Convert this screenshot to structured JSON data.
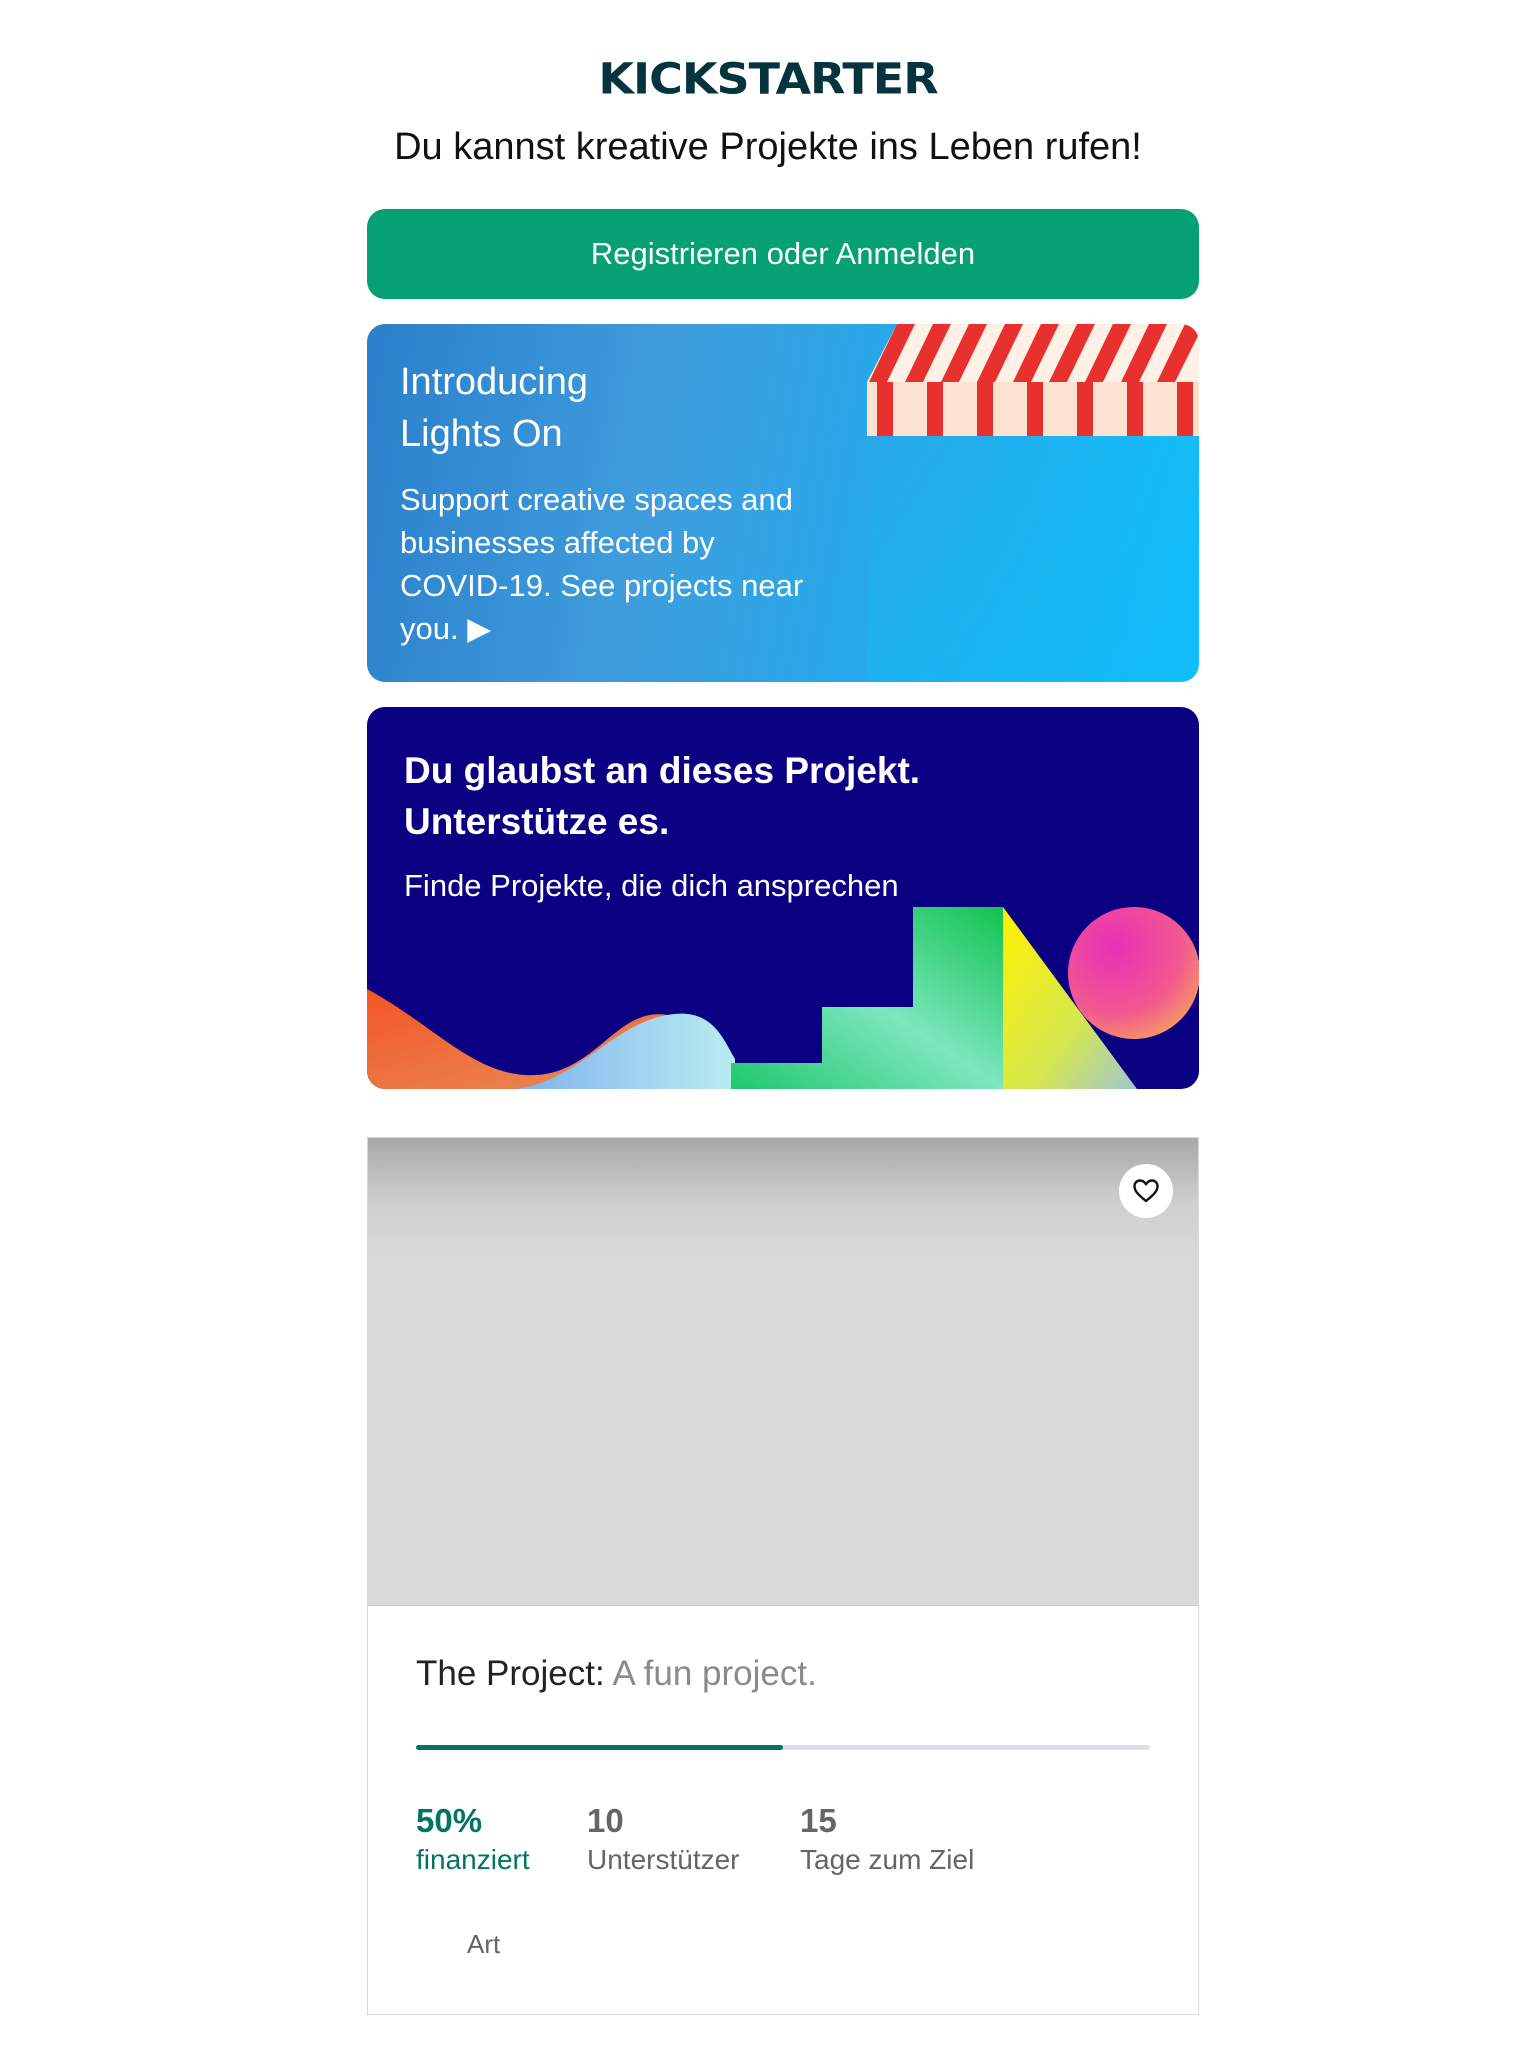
{
  "header": {
    "logo_text": "KICKSTARTER",
    "tagline": "Du kannst kreative Projekte ins Leben rufen!"
  },
  "signup_button": {
    "label": "Registrieren oder Anmelden"
  },
  "lights_on_card": {
    "title_line1": "Introducing",
    "title_line2": "Lights On",
    "body": "Support creative spaces and businesses affected by COVID-19. See projects near you. ▶"
  },
  "back_project_card": {
    "title_line1": "Du glaubst an dieses Projekt.",
    "title_line2": "Unterstütze es.",
    "subtitle": "Finde Projekte, die dich ansprechen"
  },
  "project": {
    "name": "The Project:",
    "blurb": "A fun project.",
    "progress_fraction": 0.5,
    "funded_value": "50%",
    "funded_label": "finanziert",
    "backers_value": "10",
    "backers_label": "Unterstützer",
    "days_value": "15",
    "days_label": "Tage zum Ziel",
    "category": "Art",
    "save_icon": "heart-icon"
  },
  "colors": {
    "brand_green": "#05a073",
    "logo_dark": "#05343f",
    "progress_green": "#037362",
    "banner_navy": "#0b0082"
  }
}
